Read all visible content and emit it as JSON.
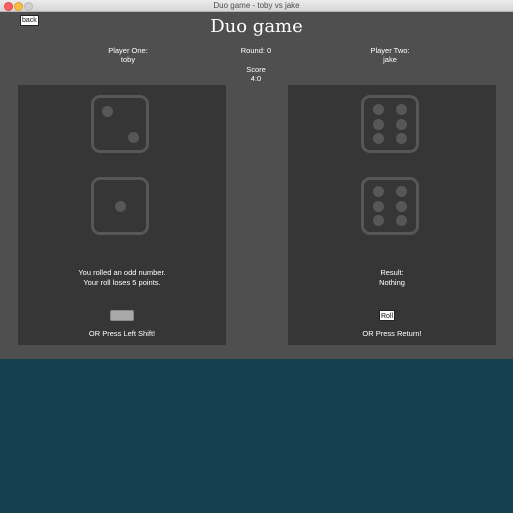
{
  "window": {
    "title": "Duo game - toby vs jake"
  },
  "back_button": {
    "label": "back"
  },
  "game": {
    "title": "Duo game"
  },
  "player_one": {
    "heading": "Player One:",
    "name": "toby"
  },
  "round": {
    "label": "Round: 0"
  },
  "score": {
    "heading": "Score",
    "value": "4:0"
  },
  "player_two": {
    "heading": "Player Two:",
    "name": "jake"
  },
  "left_panel": {
    "dice_values": [
      2,
      1
    ],
    "message_line1": "You rolled an odd number.",
    "message_line2": "Your roll loses 5 points.",
    "roll_button_label": "",
    "hint": "OR Press Left Shift!"
  },
  "right_panel": {
    "dice_values": [
      6,
      6
    ],
    "message_line1": "Result:",
    "message_line2": "Nothing",
    "roll_button_label": "Roll",
    "hint": "OR Press Return!"
  },
  "colors": {
    "app_background": "#4f4f4f",
    "panel_background": "#363636",
    "dice_color": "#575757",
    "desktop_background": "#14404f"
  }
}
